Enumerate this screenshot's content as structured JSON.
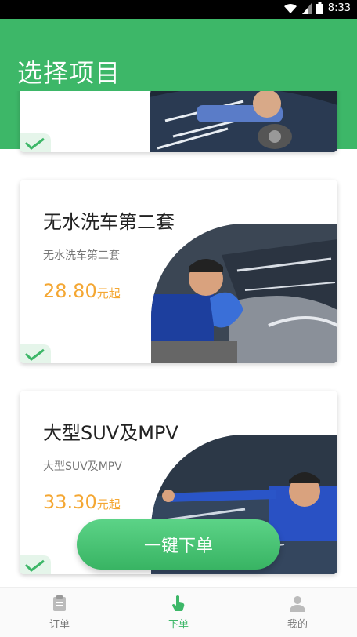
{
  "status_bar": {
    "time": "8:33"
  },
  "header": {
    "title": "选择项目"
  },
  "cards": [
    {
      "name": "",
      "subtitle": "",
      "price": "",
      "price_unit": ""
    },
    {
      "name": "无水洗车第二套",
      "subtitle": "无水洗车第二套",
      "price": "28.80",
      "price_unit": "元起"
    },
    {
      "name": "大型SUV及MPV",
      "subtitle": "大型SUV及MPV",
      "price": "33.30",
      "price_unit": "元起"
    }
  ],
  "cta": {
    "label": "一键下单"
  },
  "tabbar": {
    "items": [
      {
        "label": "订单",
        "icon": "clipboard-icon",
        "active": false
      },
      {
        "label": "下单",
        "icon": "tap-hand-icon",
        "active": true
      },
      {
        "label": "我的",
        "icon": "person-icon",
        "active": false
      }
    ]
  },
  "colors": {
    "brand_green": "#3db768",
    "price_orange": "#f4a733"
  }
}
